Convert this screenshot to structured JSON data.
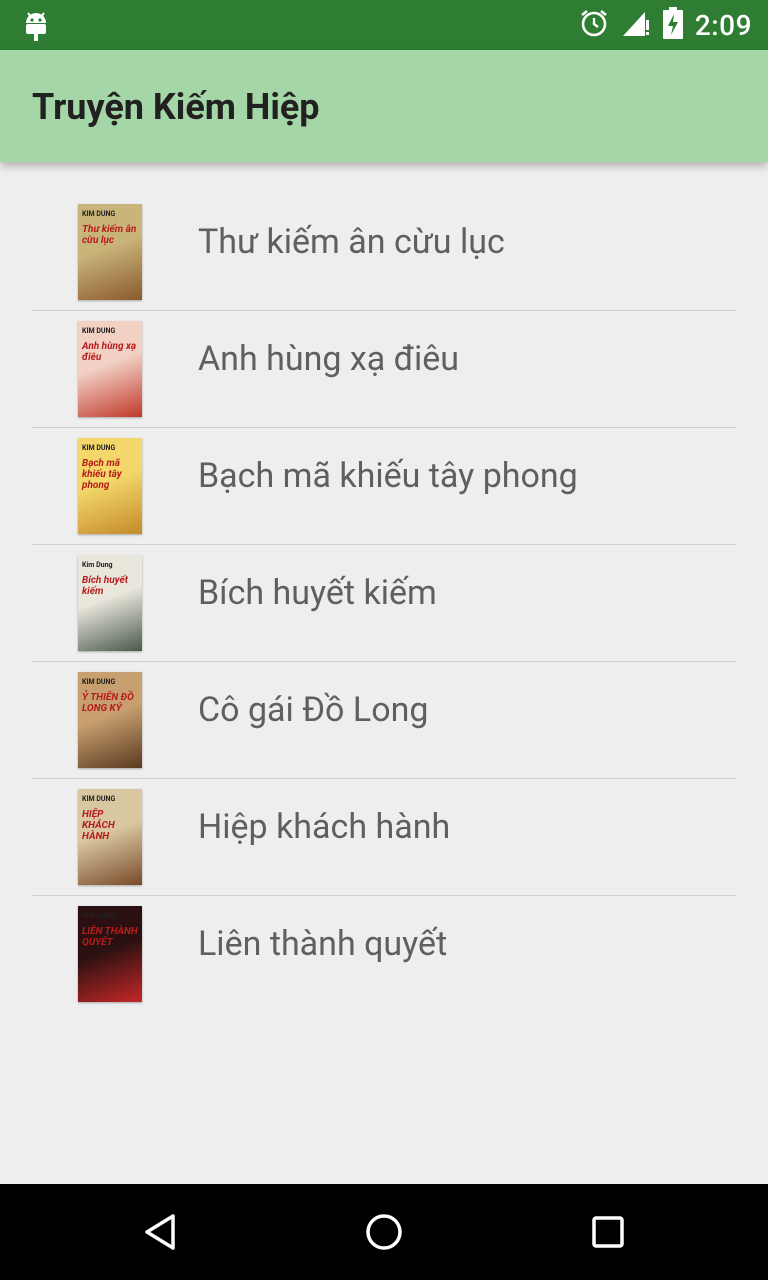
{
  "status_bar": {
    "time": "2:09",
    "icons": [
      "android-icon",
      "alarm-icon",
      "signal-icon",
      "battery-charging-icon"
    ]
  },
  "app_bar": {
    "title": "Truyện Kiếm Hiệp"
  },
  "books": [
    {
      "title": "Thư kiếm ân cừu lục",
      "cover_author": "KIM DUNG",
      "cover_text": "Thư kiếm ân cừu lục",
      "cover_colors": [
        "#c9b47a",
        "#8a5a2b"
      ]
    },
    {
      "title": "Anh hùng xạ điêu",
      "cover_author": "KIM DUNG",
      "cover_text": "Anh hùng xạ điêu",
      "cover_colors": [
        "#f2d0c4",
        "#c0392b"
      ]
    },
    {
      "title": "Bạch mã khiếu tây phong",
      "cover_author": "KIM DUNG",
      "cover_text": "Bạch mã khiếu tây phong",
      "cover_colors": [
        "#f3d76a",
        "#c48a2a"
      ]
    },
    {
      "title": "Bích huyết kiếm",
      "cover_author": "Kim Dung",
      "cover_text": "Bích huyết kiếm",
      "cover_colors": [
        "#e9e6dc",
        "#4a5a4a"
      ]
    },
    {
      "title": "Cô gái Đồ Long",
      "cover_author": "KIM DUNG",
      "cover_text": "Ỷ THIÊN ĐỒ LONG KÝ",
      "cover_colors": [
        "#c8a070",
        "#5a3a20"
      ]
    },
    {
      "title": "Hiệp khách hành",
      "cover_author": "KIM DUNG",
      "cover_text": "HIỆP KHÁCH HÀNH",
      "cover_colors": [
        "#d8c7a0",
        "#7a4a2a"
      ]
    },
    {
      "title": "Liên thành quyết",
      "cover_author": "KIM DUNG",
      "cover_text": "LIÊN THÀNH QUYẾT",
      "cover_colors": [
        "#2a1010",
        "#c62828"
      ]
    }
  ],
  "nav_bar": {
    "icons": [
      "back-icon",
      "home-icon",
      "recents-icon"
    ]
  }
}
